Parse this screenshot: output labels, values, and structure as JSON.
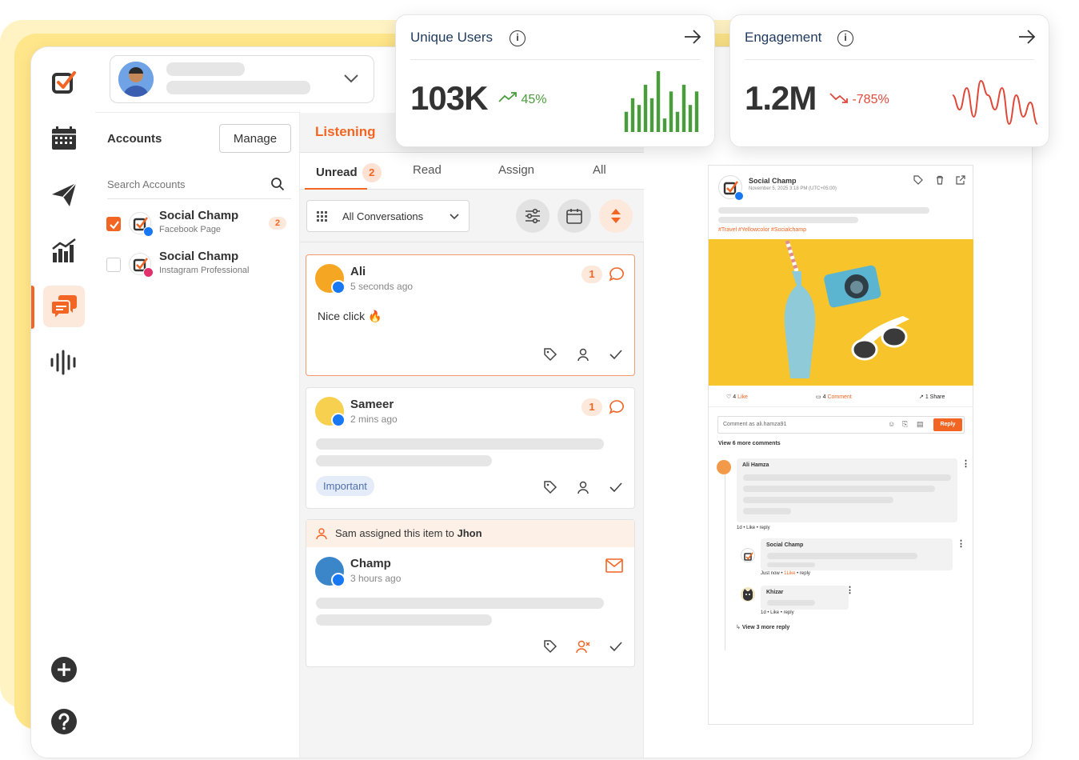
{
  "accounts_panel": {
    "title": "Accounts",
    "manage_label": "Manage",
    "search_placeholder": "Search Accounts",
    "items": [
      {
        "name": "Social Champ",
        "subtitle": "Facebook Page",
        "checked": true,
        "badge": "2",
        "network": "facebook"
      },
      {
        "name": "Social Champ",
        "subtitle": "Instagram Professional",
        "checked": false,
        "badge": "",
        "network": "instagram"
      }
    ]
  },
  "sidebar": {
    "items": [
      {
        "name": "dashboard",
        "icon": "checkbox-logo-icon"
      },
      {
        "name": "calendar",
        "icon": "calendar-icon"
      },
      {
        "name": "publish",
        "icon": "paper-plane-icon"
      },
      {
        "name": "analytics",
        "icon": "bar-chart-icon"
      },
      {
        "name": "inbox",
        "icon": "chat-bubbles-icon",
        "active": true
      },
      {
        "name": "listening",
        "icon": "sound-wave-icon"
      }
    ],
    "bottom": [
      {
        "name": "add",
        "icon": "plus-icon"
      },
      {
        "name": "help",
        "icon": "help-icon"
      }
    ],
    "accent": "#f26522"
  },
  "listening": {
    "title": "Listening",
    "tabs": [
      {
        "label": "Unread",
        "badge": "2",
        "active": true
      },
      {
        "label": "Read"
      },
      {
        "label": "Assign"
      },
      {
        "label": "All"
      }
    ],
    "filter_label": "All Conversations",
    "conversations": [
      {
        "name": "Ali",
        "time": "5 seconds ago",
        "count": "1",
        "text": "Nice click",
        "emoji": "🔥",
        "selected": true
      },
      {
        "name": "Sameer",
        "time": "2 mins ago",
        "count": "1",
        "tag": "Important"
      },
      {
        "name": "Champ",
        "time": "3 hours ago",
        "assign_note_prefix": "Sam assigned this item to ",
        "assign_note_name": "Jhon"
      }
    ]
  },
  "post_preview": {
    "author": "Social Champ",
    "date": "November 5, 2025 3:18 PM (UTC+05:00)",
    "hashtags": "#Travel #Yellowcolor #Socialchamp",
    "likes_count": "4",
    "likes_label": "Like",
    "comments_count": "4",
    "comments_label": "Comment",
    "shares_label": "1 Share",
    "comment_placeholder": "Comment as ali.hamza91",
    "reply_label": "Reply",
    "view_more_comments": "View 6 more comments",
    "comments": [
      {
        "author": "Ali Hamza",
        "meta_time": "1d",
        "meta_like": "Like",
        "meta_reply": "reply"
      },
      {
        "author": "Social Champ",
        "meta_time": "Just now",
        "meta_like": "1Like",
        "meta_reply": "reply"
      },
      {
        "author": "Khizar",
        "meta_time": "1d",
        "meta_like": "Like",
        "meta_reply": "reply"
      }
    ],
    "view_more_replies": "View 3 more reply"
  },
  "stats": [
    {
      "title": "Unique Users",
      "value": "103K",
      "change": "45%",
      "trend": "up",
      "color": "#4a9d3b"
    },
    {
      "title": "Engagement",
      "value": "1.2M",
      "change": "-785%",
      "trend": "down",
      "color": "#e0493a"
    }
  ],
  "chart_data": [
    {
      "type": "bar",
      "title": "",
      "values": [
        3,
        5,
        4,
        7,
        5,
        9,
        2,
        6,
        3,
        7,
        4,
        6
      ]
    },
    {
      "type": "line",
      "title": "",
      "values": [
        5,
        3,
        6,
        2,
        7,
        5,
        3,
        6,
        1,
        5,
        2,
        4,
        1
      ]
    }
  ]
}
